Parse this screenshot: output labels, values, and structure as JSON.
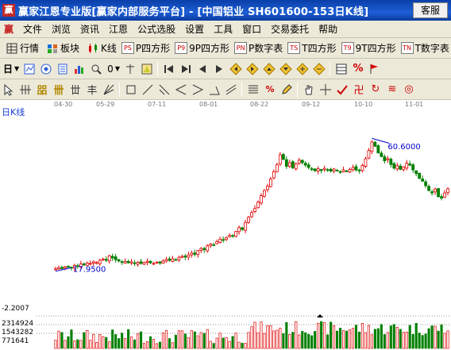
{
  "window": {
    "title": "赢家江恩专业版[赢家内部服务平台] - [中国铝业   SH601600-153日K线]",
    "service_button": "客服"
  },
  "menu": [
    "文件",
    "浏览",
    "资讯",
    "江恩",
    "公式选股",
    "设置",
    "工具",
    "窗口",
    "交易委托",
    "帮助"
  ],
  "toolbar1": [
    {
      "label": "行情",
      "icon": "grid-icon"
    },
    {
      "label": "板块",
      "icon": "blocks-icon"
    },
    {
      "label": "K线",
      "icon": "candles-icon"
    },
    {
      "badge": "PS",
      "label": "P四方形"
    },
    {
      "badge": "P9",
      "label": "9P四方形"
    },
    {
      "badge": "PN",
      "label": "P数字表"
    },
    {
      "badge": "TS",
      "label": "T四方形"
    },
    {
      "badge": "T9",
      "label": "9T四方形"
    },
    {
      "badge": "TN",
      "label": "T数字表"
    }
  ],
  "toolbar2_first": "日",
  "toolbar2_second": "0",
  "chart": {
    "label": "日K线",
    "x_ticks": [
      "04-30",
      "05-29",
      "07-11",
      "08-01",
      "08-22",
      "09-12",
      "10-10",
      "11-01"
    ],
    "high_label": "60.6000",
    "low_label": "17.9500",
    "volume_top": "-2.2007",
    "volume_ticks": [
      "2314924",
      "1543282",
      "771641"
    ]
  },
  "chart_data": {
    "type": "candlestick",
    "y_range": [
      15,
      66
    ],
    "close": [
      18.2,
      18.6,
      18.3,
      18.9,
      19.0,
      18.7,
      19.3,
      19.1,
      19.8,
      19.5,
      20.1,
      20.0,
      20.5,
      20.3,
      21.0,
      21.4,
      21.0,
      22.5,
      21.8,
      21.2,
      20.8,
      20.3,
      20.6,
      20.2,
      20.5,
      20.1,
      20.4,
      20.0,
      20.3,
      20.7,
      20.2,
      20.0,
      20.4,
      20.1,
      20.8,
      21.3,
      21.0,
      21.5,
      21.2,
      22.0,
      22.3,
      22.1,
      22.8,
      23.4,
      23.0,
      24.2,
      24.9,
      24.5,
      25.8,
      26.4,
      26.1,
      27.2,
      28.0,
      27.6,
      28.5,
      29.2,
      29.0,
      30.5,
      31.8,
      31.2,
      33.5,
      35.2,
      36.8,
      38.1,
      40.2,
      42.3,
      44.0,
      45.5,
      47.8,
      50.2,
      52.5,
      55.8,
      54.3,
      52.0,
      53.2,
      51.5,
      52.8,
      54.0,
      53.2,
      52.4,
      51.6,
      51.0,
      50.5,
      51.2,
      50.6,
      51.3,
      50.9,
      50.4,
      51.1,
      50.6,
      50.2,
      50.8,
      50.4,
      51.0,
      51.6,
      50.8,
      50.5,
      52.3,
      54.5,
      57.2,
      60.0,
      58.6,
      56.4,
      55.2,
      53.8,
      54.5,
      52.6,
      51.4,
      52.2,
      51.0,
      51.8,
      53.0,
      52.4,
      50.8,
      49.6,
      48.0,
      47.1,
      45.6,
      44.0,
      43.2,
      44.5,
      42.0,
      41.5,
      43.2,
      44.6
    ],
    "volume_scale": [
      0,
      2314924
    ]
  }
}
